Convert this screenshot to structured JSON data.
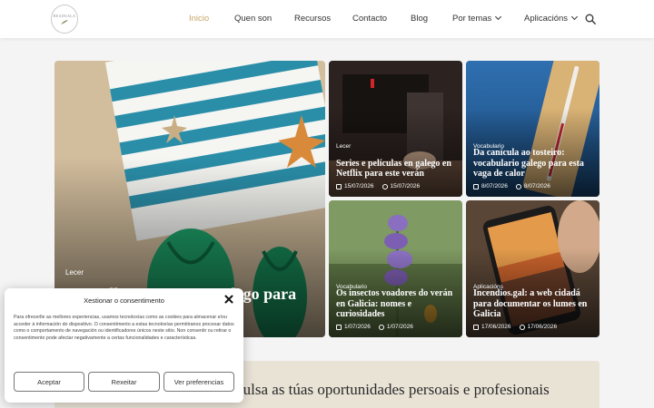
{
  "header": {
    "logo_text": "BEADGALA",
    "nav": [
      {
        "label": "Inicio",
        "active": true,
        "dropdown": false
      },
      {
        "label": "Quen son",
        "active": false,
        "dropdown": false
      },
      {
        "label": "Recursos",
        "active": false,
        "dropdown": false
      },
      {
        "label": "Contacto",
        "active": false,
        "dropdown": false
      },
      {
        "label": "Blog",
        "active": false,
        "dropdown": false
      },
      {
        "label": "Por temas",
        "active": false,
        "dropdown": true
      },
      {
        "label": "Aplicacións",
        "active": false,
        "dropdown": true
      }
    ],
    "search_icon": "search-icon",
    "accent_color": "#c7a56a"
  },
  "featured": {
    "category": "Lecer",
    "title": "Os mellores xogos en galego para"
  },
  "cards": [
    {
      "category": "Lecer",
      "title": "Series e películas en galego en Netflix para este verán",
      "date": "15/07/2026",
      "updated": "15/07/2026"
    },
    {
      "category": "Vocabulario",
      "title": "Da canícula ao tosteiro: vocabulario galego para esta vaga de calor",
      "date": "8/07/2026",
      "updated": "8/07/2026"
    },
    {
      "category": "Vocabulario",
      "title": "Os insectos voadores do verán en Galicia: nomes e curiosidades",
      "date": "1/07/2026",
      "updated": "1/07/2026"
    },
    {
      "category": "Aplicacións",
      "title": "Incendios.gal: a web cidadá para documentar os lumes en Galicia",
      "date": "17/06/2026",
      "updated": "17/06/2026"
    }
  ],
  "banner": {
    "text": "Mellora o teu galego e impulsa as túas oportunidades persoais e profesionais"
  },
  "consent": {
    "title": "Xestionar o consentimento",
    "body": "Para ofrecerlle as mellores experiencias, usamos tecnoloxías como as cookies para almacenar e/ou acceder á información do dispositivo. O consentimento a estas tecnoloxías permitiranos procesar datos como o comportamento de navegación ou identificadores únicos neste sitio. Non consentir ou retirar o consentimento pode afectar negativamente a certas funcionalidades e características.",
    "accept": "Aceptar",
    "reject": "Rexeitar",
    "preferences": "Ver preferencias"
  }
}
